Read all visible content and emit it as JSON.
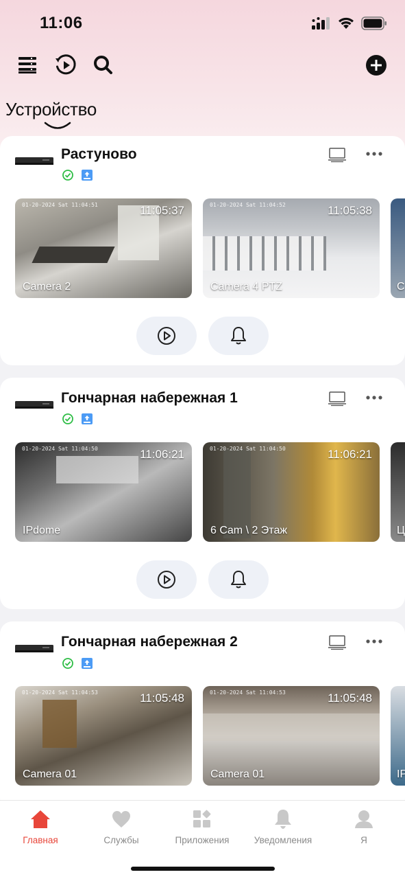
{
  "status": {
    "time": "11:06"
  },
  "header": {
    "icons": [
      "list-icon",
      "playback-icon",
      "search-icon",
      "add-icon"
    ],
    "tab_title": "Устройство"
  },
  "devices": [
    {
      "name": "Растуново",
      "cameras": [
        {
          "name": "Camera 2",
          "time": "11:05:37",
          "stamp": "01-20-2024 Sat 11:04:51"
        },
        {
          "name": "Camera 4 PTZ",
          "time": "11:05:38",
          "stamp": "01-20-2024 Sat 11:04:52"
        },
        {
          "name": "C",
          "time": "",
          "stamp": ""
        }
      ]
    },
    {
      "name": "Гончарная набережная 1",
      "cameras": [
        {
          "name": "IPdome",
          "time": "11:06:21",
          "stamp": "01-20-2024 Sat 11:04:50"
        },
        {
          "name": "6 Cam \\ 2 Этаж",
          "time": "11:06:21",
          "stamp": "01-20-2024 Sat 11:04:50"
        },
        {
          "name": "Ц",
          "time": "",
          "stamp": ""
        }
      ]
    },
    {
      "name": "Гончарная набережная 2",
      "cameras": [
        {
          "name": "Camera 01",
          "time": "11:05:48",
          "stamp": "01-20-2024 Sat 11:04:53"
        },
        {
          "name": "Camera 01",
          "time": "11:05:48",
          "stamp": "01-20-2024 Sat 11:04:53"
        },
        {
          "name": "IP",
          "time": "",
          "stamp": ""
        }
      ]
    }
  ],
  "nav": [
    {
      "label": "Главная",
      "icon": "home-icon",
      "active": true
    },
    {
      "label": "Службы",
      "icon": "heart-icon",
      "active": false
    },
    {
      "label": "Приложения",
      "icon": "apps-icon",
      "active": false
    },
    {
      "label": "Уведомления",
      "icon": "bell-icon",
      "active": false
    },
    {
      "label": "Я",
      "icon": "user-icon",
      "active": false
    }
  ],
  "colors": {
    "accent": "#e8463a",
    "online": "#2ebd45",
    "storage": "#4c9bf5"
  }
}
